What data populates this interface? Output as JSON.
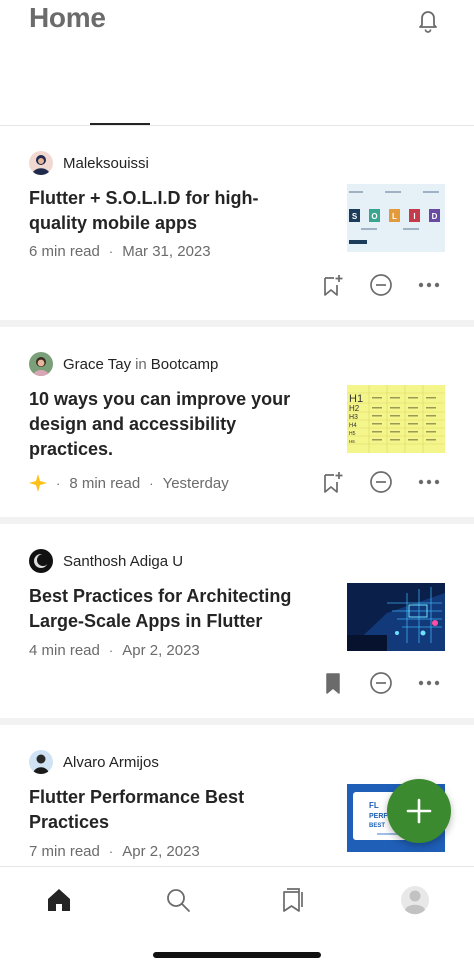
{
  "header": {
    "title": "Home"
  },
  "articles": [
    {
      "author": "Maleksouissi",
      "publication": "",
      "title_lines": [
        "Flutter + S.O.L.I.D for high-",
        "quality mobile apps"
      ],
      "read_time": "6 min read",
      "date": "Mar 31, 2023",
      "thumb_letters": [
        "S",
        "O",
        "L",
        "I",
        "D"
      ],
      "saved": false,
      "member_only": false
    },
    {
      "author": "Grace Tay",
      "in_word": "in",
      "publication": "Bootcamp",
      "title_lines": [
        "10 ways you can improve your",
        "design and accessibility",
        "practices."
      ],
      "read_time": "8 min read",
      "date": "Yesterday",
      "thumb_headings": [
        "H1",
        "H2",
        "H3",
        "H4",
        "H5",
        "H6"
      ],
      "saved": false,
      "member_only": true
    },
    {
      "author": "Santhosh Adiga U",
      "publication": "",
      "title_lines": [
        "Best Practices for Architecting",
        "Large-Scale Apps in Flutter"
      ],
      "read_time": "4 min read",
      "date": "Apr 2, 2023",
      "saved": true,
      "member_only": false
    },
    {
      "author": "Alvaro Armijos",
      "publication": "",
      "title_lines": [
        "Flutter Performance Best",
        "Practices"
      ],
      "read_time": "7 min read",
      "date": "Apr 2, 2023",
      "thumb_lines": [
        "FL",
        "PERF",
        "BEST"
      ],
      "saved": false,
      "member_only": false
    }
  ],
  "separator": "·",
  "colors": {
    "accent": "#3b8a2f",
    "title": "#242424",
    "meta": "#6b6b6b",
    "star": "#ffc017"
  },
  "tabbar": {
    "items": [
      "home-icon",
      "search-icon",
      "bookmarks-icon",
      "profile-icon"
    ]
  }
}
